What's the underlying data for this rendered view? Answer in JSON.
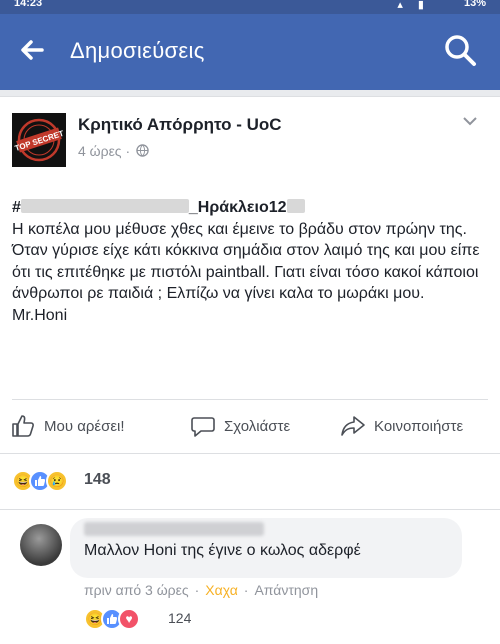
{
  "status_bar": {
    "time": "14:23",
    "battery": "13%"
  },
  "app_bar": {
    "title": "Δημοσιεύσεις"
  },
  "post": {
    "page_name": "Κρητικό Απόρρητο - UoC",
    "time": "4 ώρες",
    "hashtag_prefix": "#",
    "hashtag_suffix": "_Ηράκλειο12",
    "body": "Η κοπέλα μου μέθυσε χθες και έμεινε το βράδυ στον πρώην της. Όταν γύρισε είχε κάτι κόκκινα σημάδια στον λαιμό της και μου είπε ότι τις επιτέθηκε με πιστόλι paintball. Γιατι είναι τόσο κακοί κάποιοι άνθρωποι ρε παιδιά ; Ελπίζω να γίνει καλα το μωράκι μου.",
    "signature": "Mr.Honi",
    "avatar_label": "TOP SECRET"
  },
  "actions": {
    "like": "Μου αρέσει!",
    "comment": "Σχολιάστε",
    "share": "Κοινοποιήστε"
  },
  "reactions": {
    "count": "148",
    "types": [
      "haha-icon",
      "like-icon",
      "sad-icon"
    ]
  },
  "comment": {
    "text": "Μαλλον Honi της έγινε ο κωλος αδερφέ",
    "time": "πριν από 3 ώρες",
    "reaction": "Χαχα",
    "reply": "Απάντηση",
    "reaction_count": "124"
  },
  "colors": {
    "brand": "#4267b2",
    "statusbar": "#3b5998",
    "haha": "#f7b125"
  }
}
